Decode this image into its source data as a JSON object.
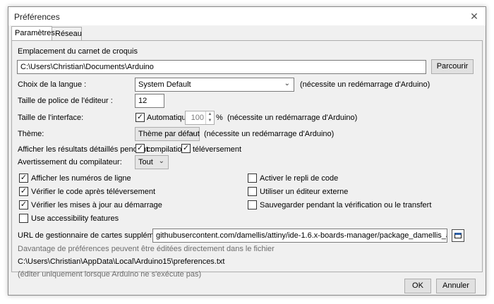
{
  "window": {
    "title": "Préférences"
  },
  "tabs": [
    {
      "label": "Paramètres"
    },
    {
      "label": "Réseau"
    }
  ],
  "sketchbook": {
    "label": "Emplacement du carnet de croquis",
    "path": "C:\\Users\\Christian\\Documents\\Arduino",
    "browse_label": "Parcourir"
  },
  "language": {
    "label": "Choix de la langue :",
    "value": "System Default",
    "note": "(nécessite un redémarrage d'Arduino)"
  },
  "editor_font": {
    "label": "Taille de police de l'éditeur :",
    "value": "12"
  },
  "interface_scale": {
    "label": "Taille de l'interface:",
    "auto_label": "Automatique",
    "auto_checked": true,
    "value": "100",
    "unit": "%",
    "note": "(nécessite un redémarrage d'Arduino)"
  },
  "theme": {
    "label": "Thème:",
    "value": "Thème par défaut",
    "note": "(nécessite un redémarrage d'Arduino)"
  },
  "verbose": {
    "label": "Afficher les résultats détaillés pendant :",
    "compilation_label": "compilation",
    "compilation_checked": true,
    "upload_label": "téléversement",
    "upload_checked": true
  },
  "warnings": {
    "label": "Avertissement du compilateur:",
    "value": "Tout"
  },
  "options_left": [
    {
      "label": "Afficher les numéros de ligne",
      "checked": true
    },
    {
      "label": "Vérifier le code après téléversement",
      "checked": true
    },
    {
      "label": "Vérifier les mises à jour au démarrage",
      "checked": true
    },
    {
      "label": "Use accessibility features",
      "checked": false
    }
  ],
  "options_right": [
    {
      "label": "Activer le repli de code",
      "checked": false
    },
    {
      "label": "Utiliser un éditeur externe",
      "checked": false
    },
    {
      "label": "Sauvegarder pendant la vérification ou le transfert",
      "checked": false
    }
  ],
  "boards_url": {
    "label": "URL de gestionnaire de cartes supplémentaires",
    "value": "githubusercontent.com/damellis/attiny/ide-1.6.x-boards-manager/package_damellis_attiny_index.json"
  },
  "more_prefs": {
    "note": "Davantage de préférences peuvent être éditées directement dans le fichier",
    "path": "C:\\Users\\Christian\\AppData\\Local\\Arduino15\\preferences.txt",
    "hint": "(éditer uniquement lorsque Arduino ne s'exécute pas)"
  },
  "footer": {
    "ok_label": "OK",
    "cancel_label": "Annuler"
  }
}
